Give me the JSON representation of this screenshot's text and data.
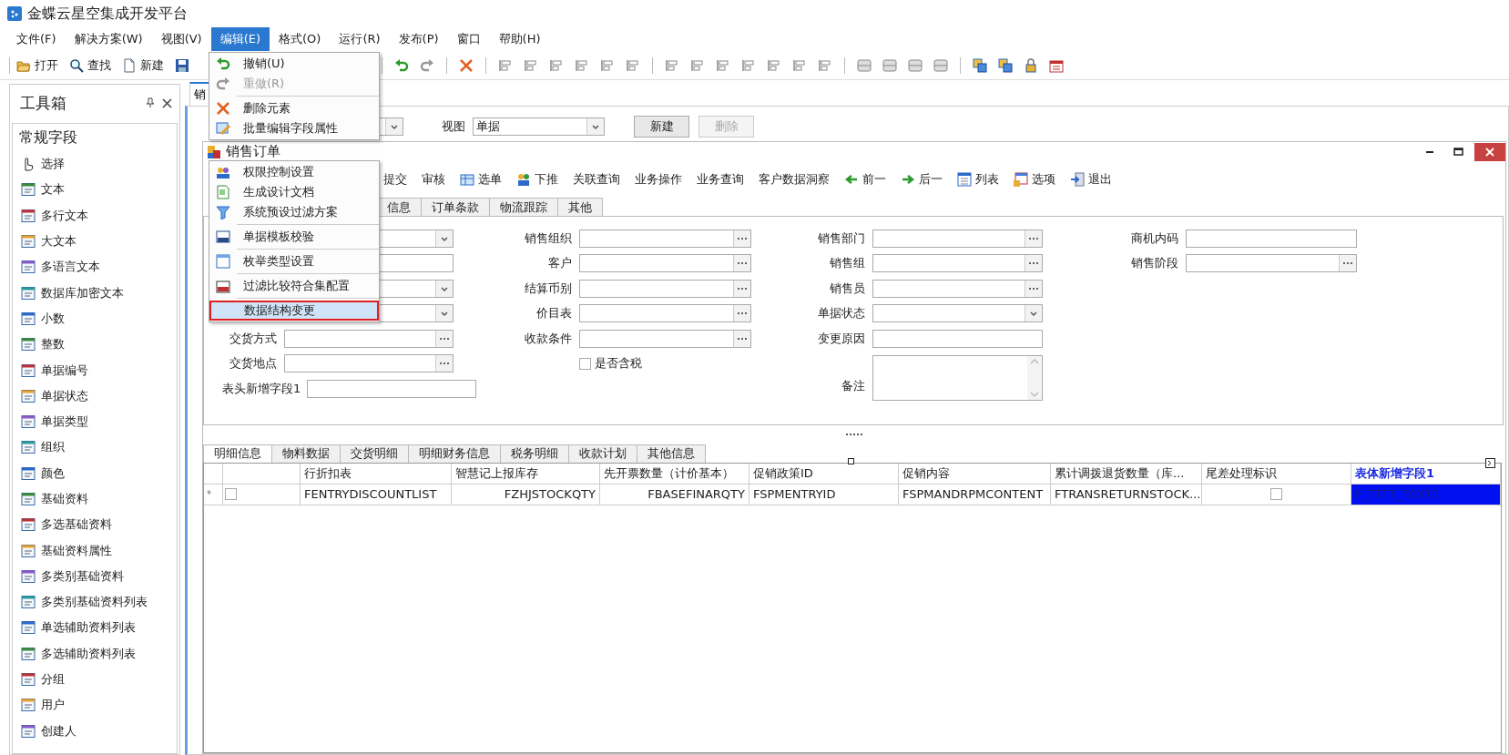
{
  "window": {
    "title": "金蝶云星空集成开发平台"
  },
  "menu_bar": [
    {
      "label": "文件(F)",
      "selected": false
    },
    {
      "label": "解决方案(W)",
      "selected": false
    },
    {
      "label": "视图(V)",
      "selected": false
    },
    {
      "label": "编辑(E)",
      "selected": true
    },
    {
      "label": "格式(O)",
      "selected": false
    },
    {
      "label": "运行(R)",
      "selected": false
    },
    {
      "label": "发布(P)",
      "selected": false
    },
    {
      "label": "窗口",
      "selected": false
    },
    {
      "label": "帮助(H)",
      "selected": false
    }
  ],
  "toolbar": {
    "left": [
      {
        "kind": "open",
        "label": "打开"
      },
      {
        "kind": "find",
        "label": "查找"
      },
      {
        "kind": "new",
        "label": "新建"
      },
      {
        "kind": "save"
      }
    ],
    "right": [
      {
        "kind": "export"
      },
      {
        "kind": "separator"
      },
      {
        "kind": "undo"
      },
      {
        "kind": "redo"
      },
      {
        "kind": "separator"
      },
      {
        "kind": "delete"
      },
      {
        "kind": "separator"
      },
      {
        "kind": "align"
      },
      {
        "kind": "align"
      },
      {
        "kind": "align"
      },
      {
        "kind": "align"
      },
      {
        "kind": "align"
      },
      {
        "kind": "align"
      },
      {
        "kind": "separator"
      },
      {
        "kind": "align"
      },
      {
        "kind": "align"
      },
      {
        "kind": "align"
      },
      {
        "kind": "align"
      },
      {
        "kind": "align"
      },
      {
        "kind": "align"
      },
      {
        "kind": "align"
      },
      {
        "kind": "separator"
      },
      {
        "kind": "panel"
      },
      {
        "kind": "panel"
      },
      {
        "kind": "panel"
      },
      {
        "kind": "panel"
      },
      {
        "kind": "separator"
      },
      {
        "kind": "stack"
      },
      {
        "kind": "stack"
      },
      {
        "kind": "lock"
      },
      {
        "kind": "calendar"
      }
    ]
  },
  "toolbox": {
    "title": "工具箱",
    "section": "常规字段",
    "items": [
      {
        "kind": "pointer",
        "label": "选择"
      },
      {
        "kind": "field",
        "label": "文本"
      },
      {
        "kind": "field",
        "label": "多行文本"
      },
      {
        "kind": "field",
        "label": "大文本"
      },
      {
        "kind": "field",
        "label": "多语言文本"
      },
      {
        "kind": "field",
        "label": "数据库加密文本"
      },
      {
        "kind": "field",
        "label": "小数"
      },
      {
        "kind": "field",
        "label": "整数"
      },
      {
        "kind": "field",
        "label": "单据编号"
      },
      {
        "kind": "field",
        "label": "单据状态"
      },
      {
        "kind": "field",
        "label": "单据类型"
      },
      {
        "kind": "field",
        "label": "组织"
      },
      {
        "kind": "field",
        "label": "颜色"
      },
      {
        "kind": "field",
        "label": "基础资料"
      },
      {
        "kind": "field",
        "label": "多选基础资料"
      },
      {
        "kind": "field",
        "label": "基础资料属性"
      },
      {
        "kind": "field",
        "label": "多类别基础资料"
      },
      {
        "kind": "field",
        "label": "多类别基础资料列表"
      },
      {
        "kind": "field",
        "label": "单选辅助资料列表"
      },
      {
        "kind": "field",
        "label": "多选辅助资料列表"
      },
      {
        "kind": "field",
        "label": "分组"
      },
      {
        "kind": "field",
        "label": "用户"
      },
      {
        "kind": "field",
        "label": "创建人"
      }
    ]
  },
  "doc_tabs": [
    {
      "label": "销",
      "selected": true
    }
  ],
  "view_bar": {
    "label": "视图",
    "value": "单据",
    "buttons": [
      {
        "label": "新建",
        "disabled": false
      },
      {
        "label": "删除",
        "disabled": true
      }
    ]
  },
  "form": {
    "title": "销售订单",
    "toolbar": [
      {
        "kind": "text",
        "label": "提交"
      },
      {
        "kind": "text",
        "label": "审核"
      },
      {
        "kind": "select",
        "label": "选单"
      },
      {
        "kind": "push",
        "label": "下推"
      },
      {
        "kind": "text",
        "label": "关联查询"
      },
      {
        "kind": "text",
        "label": "业务操作"
      },
      {
        "kind": "text",
        "label": "业务查询"
      },
      {
        "kind": "text",
        "label": "客户数据洞察"
      },
      {
        "kind": "prev",
        "label": "前一"
      },
      {
        "kind": "next",
        "label": "后一"
      },
      {
        "kind": "list",
        "label": "列表"
      },
      {
        "kind": "options",
        "label": "选项"
      },
      {
        "kind": "exit",
        "label": "退出"
      }
    ],
    "tabs": [
      {
        "label": "信息",
        "selected": false
      },
      {
        "label": "订单条款",
        "selected": false
      },
      {
        "label": "物流跟踪",
        "selected": false
      },
      {
        "label": "其他",
        "selected": false
      }
    ],
    "rows": [
      [
        {
          "kind": "dropdown"
        },
        {
          "kind": "lookup",
          "label": "销售组织"
        },
        {
          "kind": "lookup",
          "label": "销售部门"
        },
        {
          "kind": "text",
          "label": "商机内码"
        }
      ],
      [
        {
          "kind": "text"
        },
        {
          "kind": "lookup",
          "label": "客户"
        },
        {
          "kind": "lookup",
          "label": "销售组"
        },
        {
          "kind": "lookup",
          "label": "销售阶段"
        }
      ],
      [
        {
          "kind": "dropdown"
        },
        {
          "kind": "lookup",
          "label": "结算币别"
        },
        {
          "kind": "lookup",
          "label": "销售员"
        }
      ],
      [
        {
          "kind": "dropdown"
        },
        {
          "kind": "lookup",
          "label": "价目表"
        },
        {
          "kind": "dropdown",
          "label": "单据状态"
        }
      ],
      [
        {
          "kind": "lookup",
          "label": "交货方式"
        },
        {
          "kind": "lookup",
          "label": "收款条件"
        },
        {
          "kind": "text",
          "label": "变更原因"
        }
      ],
      [
        {
          "kind": "lookup",
          "label": "交货地点"
        },
        {
          "kind": "checkbox",
          "label": "是否含税",
          "checked": false
        },
        {
          "kind": "textarea",
          "label": "备注"
        }
      ]
    ],
    "extra_field": {
      "kind": "text",
      "label": "表头新增字段1"
    }
  },
  "detail": {
    "tabs": [
      {
        "label": "明细信息",
        "selected": true
      },
      {
        "label": "物料数据",
        "selected": false
      },
      {
        "label": "交货明细",
        "selected": false
      },
      {
        "label": "明细财务信息",
        "selected": false
      },
      {
        "label": "税务明细",
        "selected": false
      },
      {
        "label": "收款计划",
        "selected": false
      },
      {
        "label": "其他信息",
        "selected": false
      }
    ],
    "columns": [
      {
        "label": "行折扣表",
        "selected": false
      },
      {
        "label": "智慧记上报库存",
        "selected": false
      },
      {
        "label": "先开票数量（计价基本）",
        "selected": false
      },
      {
        "label": "促销政策ID",
        "selected": false
      },
      {
        "label": "促销内容",
        "selected": false
      },
      {
        "label": "累计调拨退货数量（库...",
        "selected": false
      },
      {
        "label": "尾差处理标识",
        "selected": false
      },
      {
        "label": "表体新增字段1",
        "selected": true
      }
    ],
    "rows": [
      {
        "marker": "*",
        "checked": false,
        "cells": [
          {
            "kind": "text",
            "text": "FENTRYDISCOUNTLIST"
          },
          {
            "kind": "number",
            "text": "FZHJSTOCKQTY"
          },
          {
            "kind": "number",
            "text": "FBASEFINARQTY"
          },
          {
            "kind": "text",
            "text": "FSPMENTRYID"
          },
          {
            "kind": "text",
            "text": "FSPMANDRPMCONTENT"
          },
          {
            "kind": "text",
            "text": "FTRANSRETURNSTOCK..."
          },
          {
            "kind": "checkbox",
            "checked": false
          },
          {
            "kind": "text",
            "text": "F_TTTT_TEXT1"
          }
        ]
      }
    ]
  },
  "edit_menu": {
    "upper": [
      {
        "kind": "item",
        "label": "撤销(U)",
        "disabled": false,
        "highlighted": false
      },
      {
        "kind": "item",
        "label": "重做(R)",
        "disabled": true,
        "highlighted": false
      },
      {
        "kind": "separator"
      },
      {
        "kind": "item",
        "label": "删除元素",
        "disabled": false,
        "highlighted": false
      },
      {
        "kind": "item",
        "label": "批量编辑字段属性",
        "disabled": false,
        "highlighted": false
      }
    ],
    "lower": [
      {
        "kind": "item",
        "label": "权限控制设置",
        "disabled": false,
        "highlighted": false
      },
      {
        "kind": "item",
        "label": "生成设计文档",
        "disabled": false,
        "highlighted": false
      },
      {
        "kind": "item",
        "label": "系统预设过滤方案",
        "disabled": false,
        "highlighted": false
      },
      {
        "kind": "separator"
      },
      {
        "kind": "item",
        "label": "单据模板校验",
        "disabled": false,
        "highlighted": false
      },
      {
        "kind": "separator"
      },
      {
        "kind": "item",
        "label": "枚举类型设置",
        "disabled": false,
        "highlighted": false
      },
      {
        "kind": "separator"
      },
      {
        "kind": "item",
        "label": "过滤比较符合集配置",
        "disabled": false,
        "highlighted": false
      },
      {
        "kind": "separator"
      },
      {
        "kind": "item",
        "label": "数据结构变更",
        "disabled": false,
        "highlighted": true
      }
    ]
  }
}
